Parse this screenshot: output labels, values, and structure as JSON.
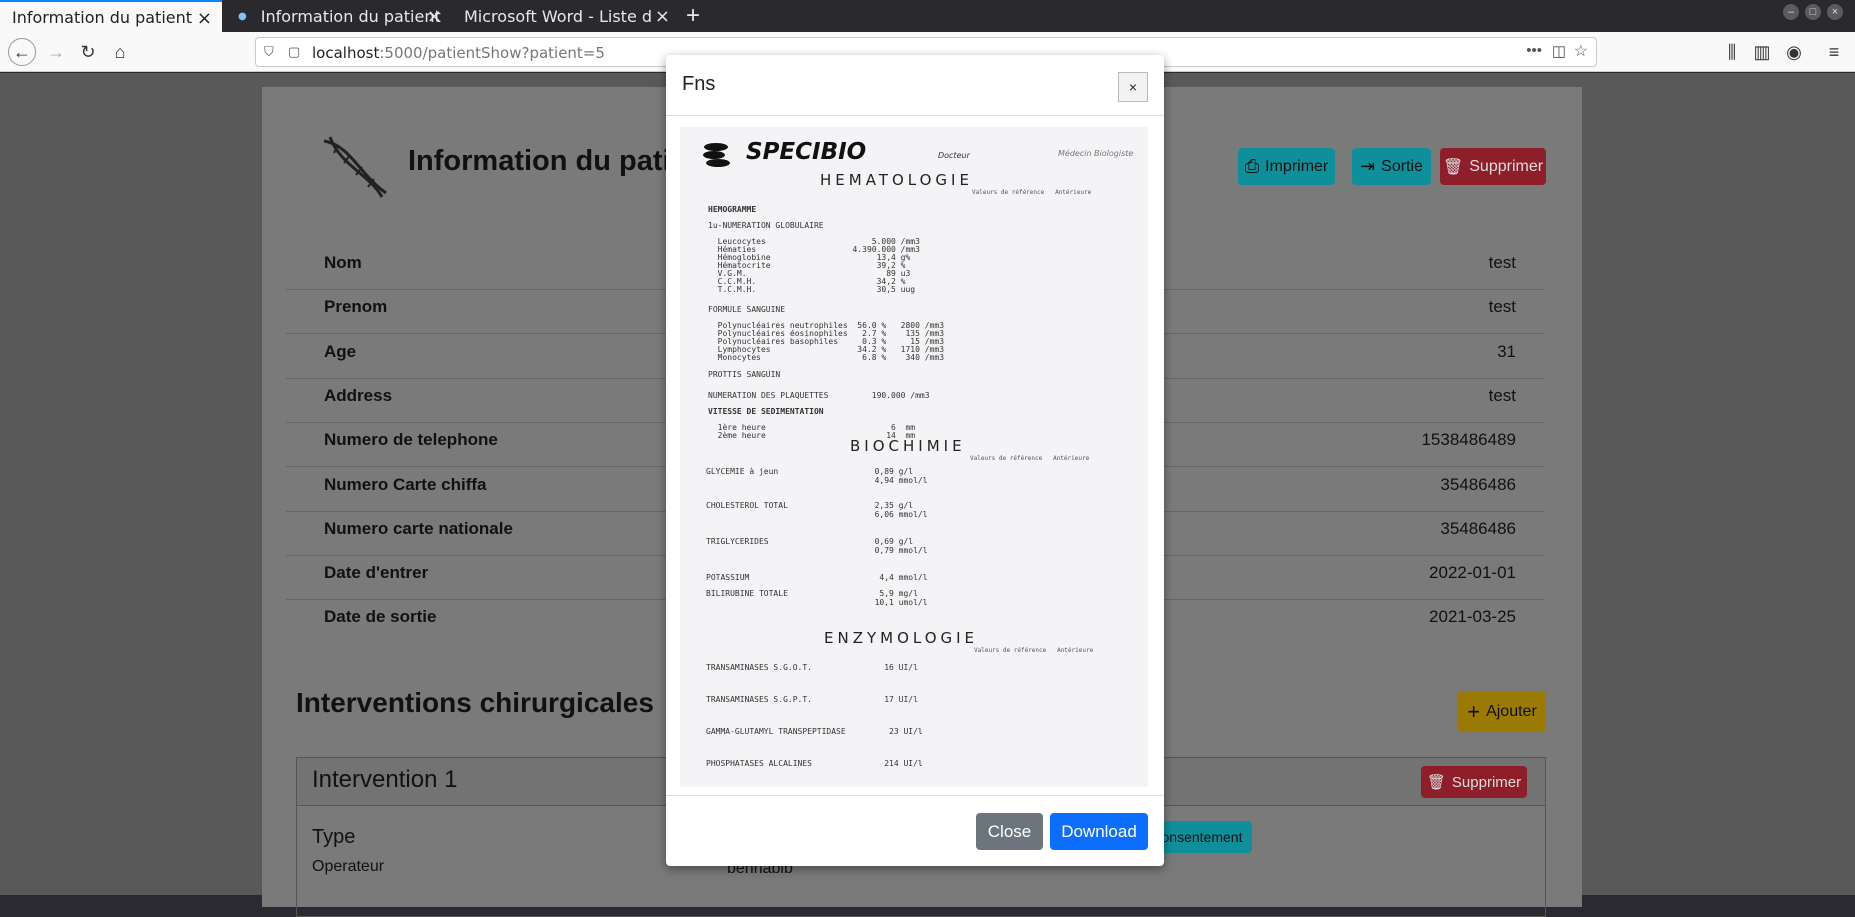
{
  "browser": {
    "tabs": [
      {
        "title": "Information du patient"
      },
      {
        "title": "Information du patient"
      },
      {
        "title": "Microsoft Word - Liste des a"
      }
    ],
    "url_host": "localhost",
    "url_rest": ":5000/patientShow?patient=5"
  },
  "page": {
    "title": "Information du patie",
    "buttons": {
      "print": "Imprimer",
      "exit": "Sortie",
      "delete": "Supprimer"
    },
    "fields": [
      {
        "label": "Nom",
        "value": "test"
      },
      {
        "label": "Prenom",
        "value": "test"
      },
      {
        "label": "Age",
        "value": "31"
      },
      {
        "label": "Address",
        "value": "test"
      },
      {
        "label": "Numero de telephone",
        "value": "1538486489"
      },
      {
        "label": "Numero Carte chiffa",
        "value": "35486486"
      },
      {
        "label": "Numero carte nationale",
        "value": "35486486"
      },
      {
        "label": "Date d'entrer",
        "value": "2022-01-01"
      },
      {
        "label": "Date de sortie",
        "value": "2021-03-25"
      }
    ],
    "interventions_title": "Interventions chirurgicales",
    "add_label": "Ajouter",
    "intervention": {
      "title": "Intervention 1",
      "delete_label": "Supprimer",
      "type_label": "Type",
      "operator_label": "Operateur",
      "operator_value": "benhabib",
      "consent_label": "onsentement"
    }
  },
  "modal": {
    "title": "Fns",
    "close_x": "×",
    "close_label": "Close",
    "download_label": "Download",
    "document": {
      "brand": "SPECIBIO",
      "doctor_label": "Docteur",
      "biologist_label": "Médecin Biologiste",
      "ref_header": "Valeurs de référence   Antérieure",
      "sections": {
        "hematologie": "HEMATOLOGIE",
        "biochimie": "BIOCHIMIE",
        "enzymologie": "ENZYMOLOGIE"
      },
      "lines": [
        "HEMOGRAMME",
        "1u-NUMERATION GLOBULAIRE",
        "  Leucocytes                      5.000 /mm3",
        "  Hématies                    4.390.000 /mm3",
        "  Hémoglobine                      13,4 g%",
        "  Hématocrite                      39,2 %",
        "  V.G.M.                             89 u3",
        "  C.C.M.H.                         34,2 %",
        "  T.C.M.H.                         30,5 uug",
        "FORMULE SANGUINE",
        "  Polynucléaires neutrophiles  56.0 %   2800 /mm3",
        "  Polynucléaires éosinophiles   2.7 %    135 /mm3",
        "  Polynucléaires basophiles     0.3 %     15 /mm3",
        "  Lymphocytes                  34.2 %   1710 /mm3",
        "  Monocytes                     6.8 %    340 /mm3",
        "PROTTIS SANGUIN",
        "NUMERATION DES PLAQUETTES         190.000 /mm3",
        "VITESSE DE SEDIMENTATION",
        "  1ère heure                          6  mm",
        "  2ème heure                         14  mm"
      ],
      "bio_lines": [
        "GLYCEMIE à jeun                    0,89 g/l",
        "                                   4,94 mmol/l",
        "CHOLESTEROL TOTAL                  2,35 g/l",
        "                                   6,06 mmol/l",
        "TRIGLYCERIDES                      0,69 g/l",
        "                                   0,79 mmol/l",
        "POTASSIUM                           4,4 mmol/l",
        "BILIRUBINE TOTALE                   5,9 mg/l",
        "                                   10,1 umol/l"
      ],
      "enz_lines": [
        "TRANSAMINASES S.G.O.T.               16 UI/l",
        "TRANSAMINASES S.G.P.T.               17 UI/l",
        "GAMMA-GLUTAMYL TRANSPEPTIDASE         23 UI/l",
        "PHOSPHATASES ALCALINES               214 UI/l"
      ]
    }
  }
}
